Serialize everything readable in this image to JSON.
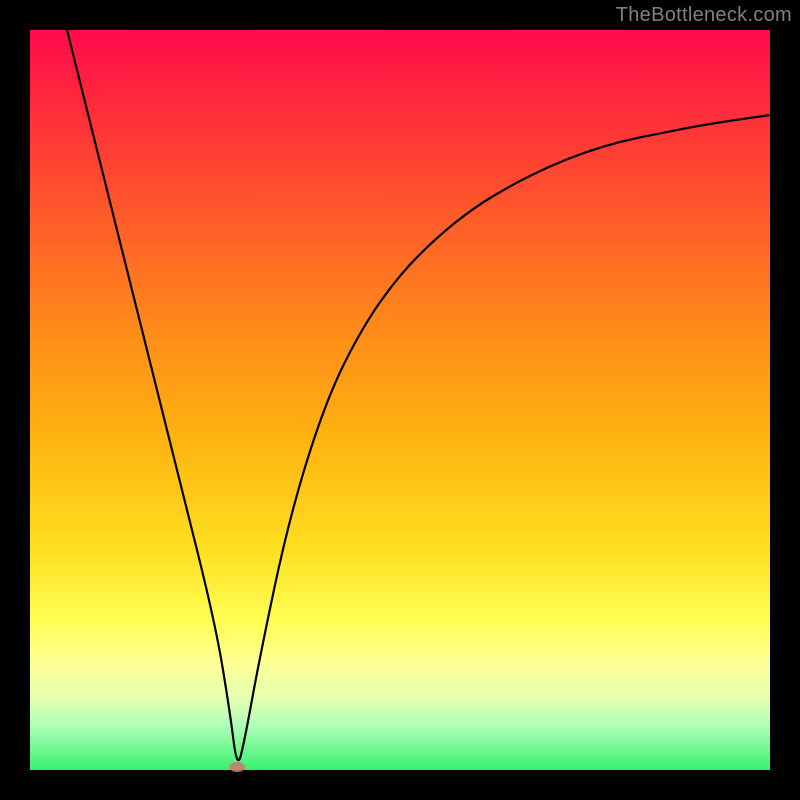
{
  "watermark": "TheBottleneck.com",
  "chart_data": {
    "type": "line",
    "title": "",
    "xlabel": "",
    "ylabel": "",
    "xlim": [
      0,
      100
    ],
    "ylim": [
      0,
      100
    ],
    "background": "red-to-green vertical gradient",
    "annotation": "small red oval marker at curve minimum",
    "minimum_x": 28,
    "series": [
      {
        "name": "curve",
        "x": [
          5,
          10,
          15,
          20,
          25,
          27,
          28,
          29,
          31,
          35,
          40,
          45,
          50,
          55,
          60,
          65,
          70,
          75,
          80,
          85,
          90,
          95,
          100
        ],
        "values": [
          100,
          80,
          60,
          40,
          20,
          8,
          0,
          4,
          15,
          34,
          50,
          60,
          67,
          72,
          76,
          79,
          81.5,
          83.5,
          85,
          86,
          87,
          87.8,
          88.5
        ]
      }
    ]
  }
}
